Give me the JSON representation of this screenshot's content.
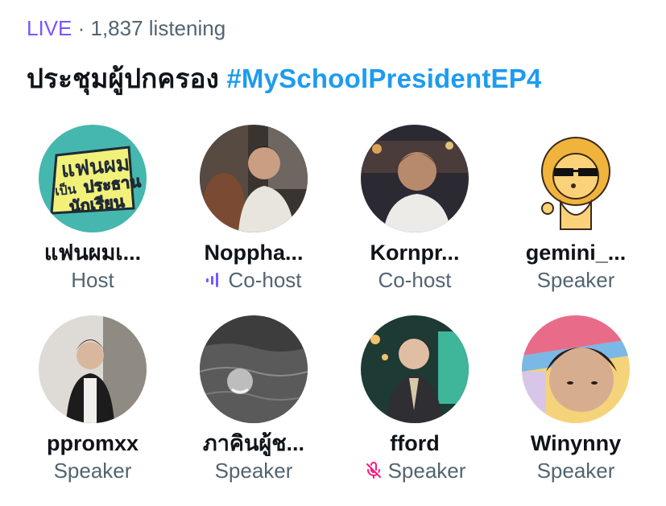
{
  "header": {
    "live_label": "LIVE",
    "separator": " · ",
    "listening": "1,837 listening"
  },
  "space": {
    "title_thai": "ประชุมผู้ปกครอง",
    "hashtag": "#MySchoolPresidentEP4"
  },
  "colors": {
    "live": "#7856ff",
    "hashtag": "#1d9bf0",
    "muted_icon": "#f91880",
    "speaking_icon": "#7856ff"
  },
  "participants": [
    {
      "name": "แฟนผมเ...",
      "role": "Host",
      "avatar": "show-logo-avatar"
    },
    {
      "name": "Noppha...",
      "role": "Co-host",
      "avatar": "photo-avatar",
      "status_icon": "speaking-bars-icon"
    },
    {
      "name": "Kornpr...",
      "role": "Co-host",
      "avatar": "photo-avatar"
    },
    {
      "name": "gemini_...",
      "role": "Speaker",
      "avatar": "lion-cartoon-avatar"
    },
    {
      "name": "ppromxx",
      "role": "Speaker",
      "avatar": "photo-avatar"
    },
    {
      "name": "ภาคินผู้ช...",
      "role": "Speaker",
      "avatar": "photo-avatar"
    },
    {
      "name": "fford",
      "role": "Speaker",
      "avatar": "photo-avatar",
      "status_icon": "muted-mic-icon"
    },
    {
      "name": "Winynny",
      "role": "Speaker",
      "avatar": "photo-avatar"
    }
  ],
  "logo_text": [
    "แฟนผม",
    "เป็น",
    "ประธาน",
    "นักเรียน"
  ]
}
